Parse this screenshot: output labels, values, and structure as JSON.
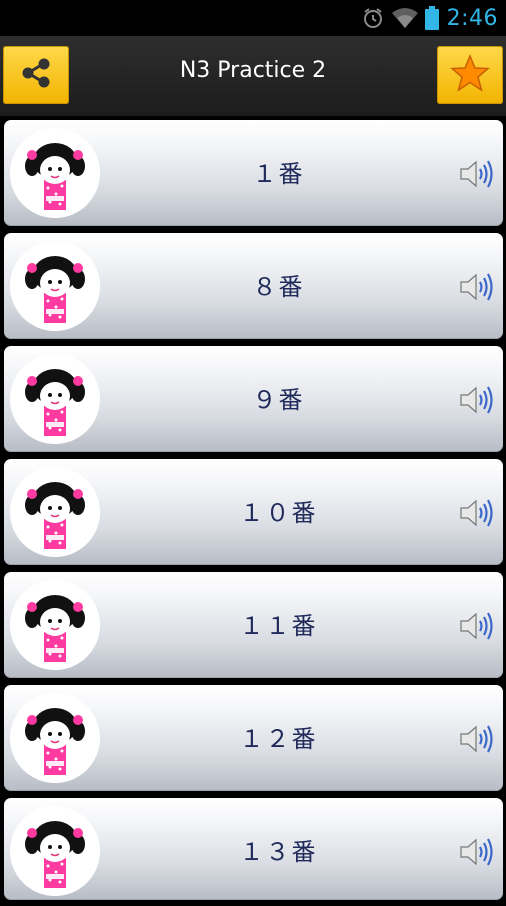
{
  "status_bar": {
    "time": "2:46",
    "icons": [
      "alarm-icon",
      "wifi-icon",
      "battery-icon"
    ],
    "color": "#31b6e7"
  },
  "toolbar": {
    "title": "N3 Practice 2",
    "share_icon": "share-icon",
    "favorite_icon": "star-icon",
    "accent": "#f5c000"
  },
  "list": {
    "items": [
      {
        "label": "１番"
      },
      {
        "label": "８番"
      },
      {
        "label": "９番"
      },
      {
        "label": "１０番"
      },
      {
        "label": "１１番"
      },
      {
        "label": "１２番"
      },
      {
        "label": "１３番"
      }
    ],
    "avatar_icon": "girl-avatar-icon",
    "audio_icon": "speaker-icon",
    "label_color": "#1f2a5a"
  }
}
